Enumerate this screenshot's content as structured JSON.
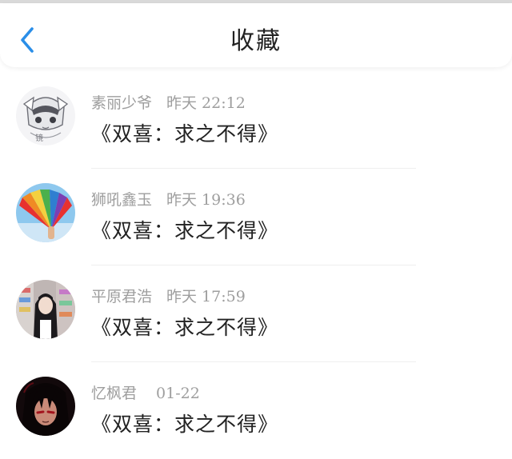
{
  "header": {
    "title": "收藏",
    "back_icon": "chevron-left-icon",
    "accent_color": "#2a8ee8"
  },
  "items": [
    {
      "user": "素丽少爷",
      "date_label": "昨天",
      "time": "22:12",
      "title": "《双喜：求之不得》",
      "avatar": "anime-sketch-avatar"
    },
    {
      "user": "狮吼鑫玉",
      "date_label": "昨天",
      "time": "19:36",
      "title": "《双喜：求之不得》",
      "avatar": "rainbow-fan-avatar"
    },
    {
      "user": "平原君浩",
      "date_label": "昨天",
      "time": "17:59",
      "title": "《双喜：求之不得》",
      "avatar": "photo-girl-avatar"
    },
    {
      "user": "忆枫君",
      "date_label": "",
      "time": "01-22",
      "title": "《双喜：求之不得》",
      "avatar": "dark-hair-anime-avatar"
    }
  ]
}
